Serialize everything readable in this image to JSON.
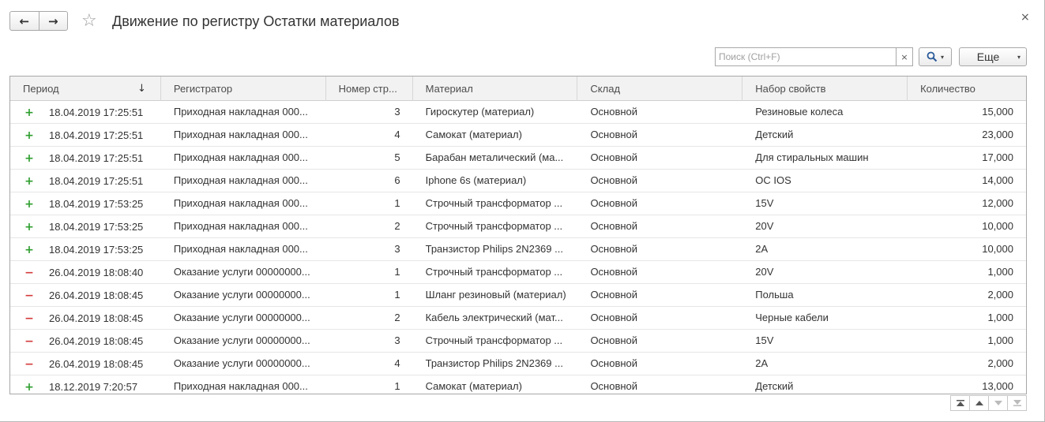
{
  "window": {
    "title": "Движение по регистру Остатки материалов",
    "back_icon": "←",
    "forward_icon": "→",
    "star_icon": "☆",
    "close_icon": "×"
  },
  "toolbar": {
    "search_placeholder": "Поиск (Ctrl+F)",
    "search_value": "",
    "search_clear_icon": "×",
    "search_dropdown_icon": "▾",
    "more_label": "Еще",
    "more_dropdown_icon": "▾"
  },
  "table": {
    "columns": [
      "Период",
      "Регистратор",
      "Номер стр...",
      "Материал",
      "Склад",
      "Набор свойств",
      "Количество"
    ],
    "sort_icon": "↓",
    "rows": [
      {
        "op": "+",
        "type": "plus",
        "period": "18.04.2019 17:25:51",
        "registrar": "Приходная накладная 000...",
        "line": "3",
        "material": "Гироскутер (материал)",
        "warehouse": "Основной",
        "props": "Резиновые колеса",
        "qty": "15,000"
      },
      {
        "op": "+",
        "type": "plus",
        "period": "18.04.2019 17:25:51",
        "registrar": "Приходная накладная 000...",
        "line": "4",
        "material": "Самокат (материал)",
        "warehouse": "Основной",
        "props": "Детский",
        "qty": "23,000"
      },
      {
        "op": "+",
        "type": "plus",
        "period": "18.04.2019 17:25:51",
        "registrar": "Приходная накладная 000...",
        "line": "5",
        "material": "Барабан металический (ма...",
        "warehouse": "Основной",
        "props": "Для стиральных машин",
        "qty": "17,000"
      },
      {
        "op": "+",
        "type": "plus",
        "period": "18.04.2019 17:25:51",
        "registrar": "Приходная накладная 000...",
        "line": "6",
        "material": "Iphone 6s (материал)",
        "warehouse": "Основной",
        "props": "ОС IOS",
        "qty": "14,000"
      },
      {
        "op": "+",
        "type": "plus",
        "period": "18.04.2019 17:53:25",
        "registrar": "Приходная накладная 000...",
        "line": "1",
        "material": "Строчный трансформатор ...",
        "warehouse": "Основной",
        "props": "15V",
        "qty": "12,000"
      },
      {
        "op": "+",
        "type": "plus",
        "period": "18.04.2019 17:53:25",
        "registrar": "Приходная накладная 000...",
        "line": "2",
        "material": "Строчный трансформатор ...",
        "warehouse": "Основной",
        "props": "20V",
        "qty": "10,000"
      },
      {
        "op": "+",
        "type": "plus",
        "period": "18.04.2019 17:53:25",
        "registrar": "Приходная накладная 000...",
        "line": "3",
        "material": "Транзистор Philips 2N2369 ...",
        "warehouse": "Основной",
        "props": "2A",
        "qty": "10,000"
      },
      {
        "op": "−",
        "type": "minus",
        "period": "26.04.2019 18:08:40",
        "registrar": "Оказание услуги 00000000...",
        "line": "1",
        "material": "Строчный трансформатор ...",
        "warehouse": "Основной",
        "props": "20V",
        "qty": "1,000"
      },
      {
        "op": "−",
        "type": "minus",
        "period": "26.04.2019 18:08:45",
        "registrar": "Оказание услуги 00000000...",
        "line": "1",
        "material": "Шланг резиновый (материал)",
        "warehouse": "Основной",
        "props": "Польша",
        "qty": "2,000"
      },
      {
        "op": "−",
        "type": "minus",
        "period": "26.04.2019 18:08:45",
        "registrar": "Оказание услуги 00000000...",
        "line": "2",
        "material": "Кабель электрический (мат...",
        "warehouse": "Основной",
        "props": "Черные кабели",
        "qty": "1,000"
      },
      {
        "op": "−",
        "type": "minus",
        "period": "26.04.2019 18:08:45",
        "registrar": "Оказание услуги 00000000...",
        "line": "3",
        "material": "Строчный трансформатор ...",
        "warehouse": "Основной",
        "props": "15V",
        "qty": "1,000"
      },
      {
        "op": "−",
        "type": "minus",
        "period": "26.04.2019 18:08:45",
        "registrar": "Оказание услуги 00000000...",
        "line": "4",
        "material": "Транзистор Philips 2N2369 ...",
        "warehouse": "Основной",
        "props": "2A",
        "qty": "2,000"
      },
      {
        "op": "+",
        "type": "plus",
        "period": "18.12.2019 7:20:57",
        "registrar": "Приходная накладная 000...",
        "line": "1",
        "material": "Самокат (материал)",
        "warehouse": "Основной",
        "props": "Детский",
        "qty": "13,000"
      }
    ]
  },
  "pager": {
    "icons": [
      "first-page-icon",
      "previous-page-icon",
      "next-page-icon",
      "last-page-icon"
    ]
  },
  "colors": {
    "plus": "#2e9e2e",
    "minus": "#d33a3a",
    "header_bg": "#f2f2f2",
    "border": "#a8a8a8"
  }
}
